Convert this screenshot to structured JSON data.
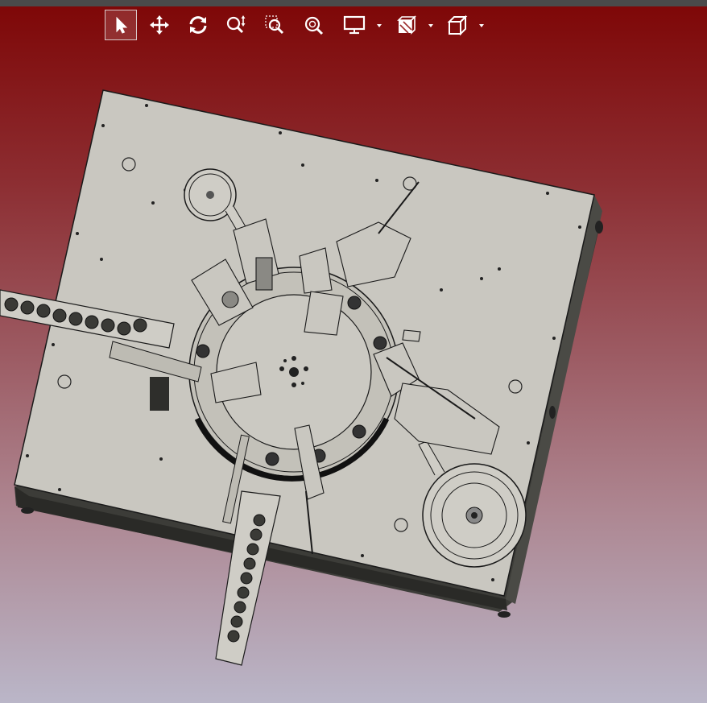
{
  "toolbar": {
    "tools": [
      {
        "name": "select-tool",
        "icon": "cursor-arrow-icon",
        "active": true
      },
      {
        "name": "pan-tool",
        "icon": "move-arrows-icon",
        "active": false
      },
      {
        "name": "rotate-tool",
        "icon": "rotate-icon",
        "active": false
      },
      {
        "name": "zoom-tool",
        "icon": "zoom-icon",
        "active": false
      },
      {
        "name": "zoom-window-tool",
        "icon": "zoom-window-icon",
        "active": false
      },
      {
        "name": "zoom-fit-tool",
        "icon": "zoom-fit-icon",
        "active": false
      },
      {
        "name": "display-mode-dropdown",
        "icon": "monitor-icon",
        "active": false
      },
      {
        "name": "section-view-dropdown",
        "icon": "section-view-icon",
        "active": false
      },
      {
        "name": "view-orientation-dropdown",
        "icon": "cube-view-icon",
        "active": false
      }
    ]
  },
  "viewport": {
    "background_top": "#7e0606",
    "background_bottom": "#bab6c8",
    "model_color": "#c9c7c0",
    "edge_color": "#1a1a1a",
    "icon_color": "#ffffff"
  }
}
